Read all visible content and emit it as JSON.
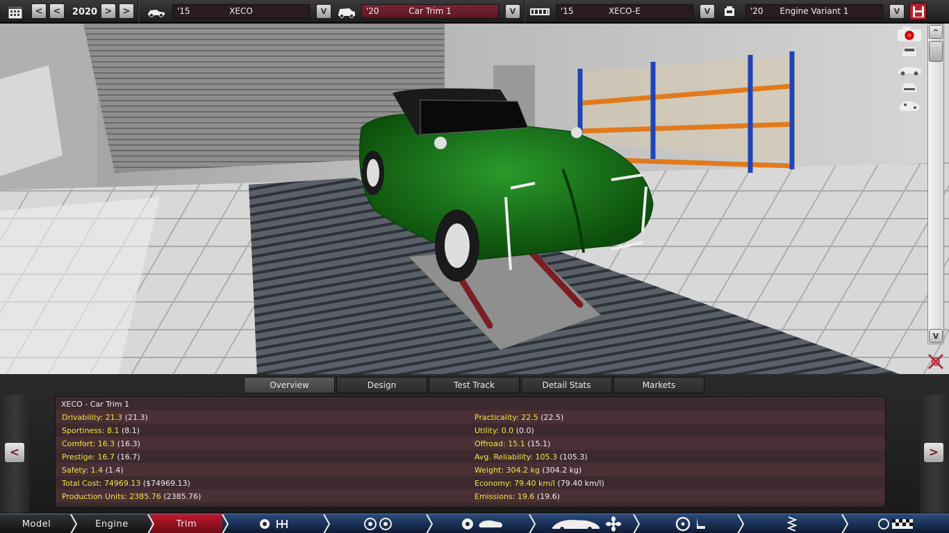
{
  "topbar": {
    "year": "2020",
    "prev_label": "<",
    "prev2_label": "<",
    "next_label": ">",
    "next2_label": ">",
    "model": {
      "year": "'15",
      "name": "XECO"
    },
    "trim": {
      "year": "'20",
      "name": "Car Trim 1"
    },
    "engine_family": {
      "year": "'15",
      "name": "XECO-E"
    },
    "engine_variant": {
      "year": "'20",
      "name": "Engine Variant 1"
    },
    "dropdown_label": "V"
  },
  "scene": {
    "scroll_up_label": "^",
    "scroll_down_label": "V",
    "side_icons": [
      "camera-icon",
      "car-front-icon",
      "car-side-icon",
      "car-rear-icon",
      "car-underside-icon"
    ]
  },
  "tabs": [
    {
      "label": "Overview",
      "active": true
    },
    {
      "label": "Design",
      "active": false
    },
    {
      "label": "Test Track",
      "active": false
    },
    {
      "label": "Detail Stats",
      "active": false
    },
    {
      "label": "Markets",
      "active": false
    }
  ],
  "panel": {
    "prev_label": "<",
    "next_label": ">",
    "title": "XECO - Car Trim 1",
    "left_stats": [
      {
        "key": "Drivability:",
        "value": "21.3",
        "paren": "(21.3)"
      },
      {
        "key": "Sportiness:",
        "value": "8.1",
        "paren": "(8.1)"
      },
      {
        "key": "Comfort:",
        "value": "16.3",
        "paren": "(16.3)"
      },
      {
        "key": "Prestige:",
        "value": "16.7",
        "paren": "(16.7)"
      },
      {
        "key": "Safety:",
        "value": "1.4",
        "paren": "(1.4)"
      },
      {
        "key": "Total Cost:",
        "value": "74969.13",
        "paren": "($74969.13)"
      },
      {
        "key": "Production Units:",
        "value": "2385.76",
        "paren": "(2385.76)"
      }
    ],
    "right_stats": [
      {
        "key": "Practicality:",
        "value": "22.5",
        "paren": "(22.5)"
      },
      {
        "key": "Utility:",
        "value": "0.0",
        "paren": "(0.0)"
      },
      {
        "key": "Offroad:",
        "value": "15.1",
        "paren": "(15.1)"
      },
      {
        "key": "Avg. Reliability:",
        "value": "105.3",
        "paren": "(105.3)"
      },
      {
        "key": "Weight:",
        "value": "304.2 kg",
        "paren": "(304.2 kg)"
      },
      {
        "key": "Economy:",
        "value": "79.40 km/l",
        "paren": "(79.40 km/l)"
      },
      {
        "key": "Emissions:",
        "value": "19.6",
        "paren": "(19.6)"
      }
    ]
  },
  "nav": {
    "model": "Model",
    "engine": "Engine",
    "trim": "Trim"
  },
  "colors": {
    "accent_red": "#c0182a",
    "stat_yellow": "#f3e34a",
    "car_green": "#1c7a1c",
    "nav_blue": "#2b4a7a"
  }
}
